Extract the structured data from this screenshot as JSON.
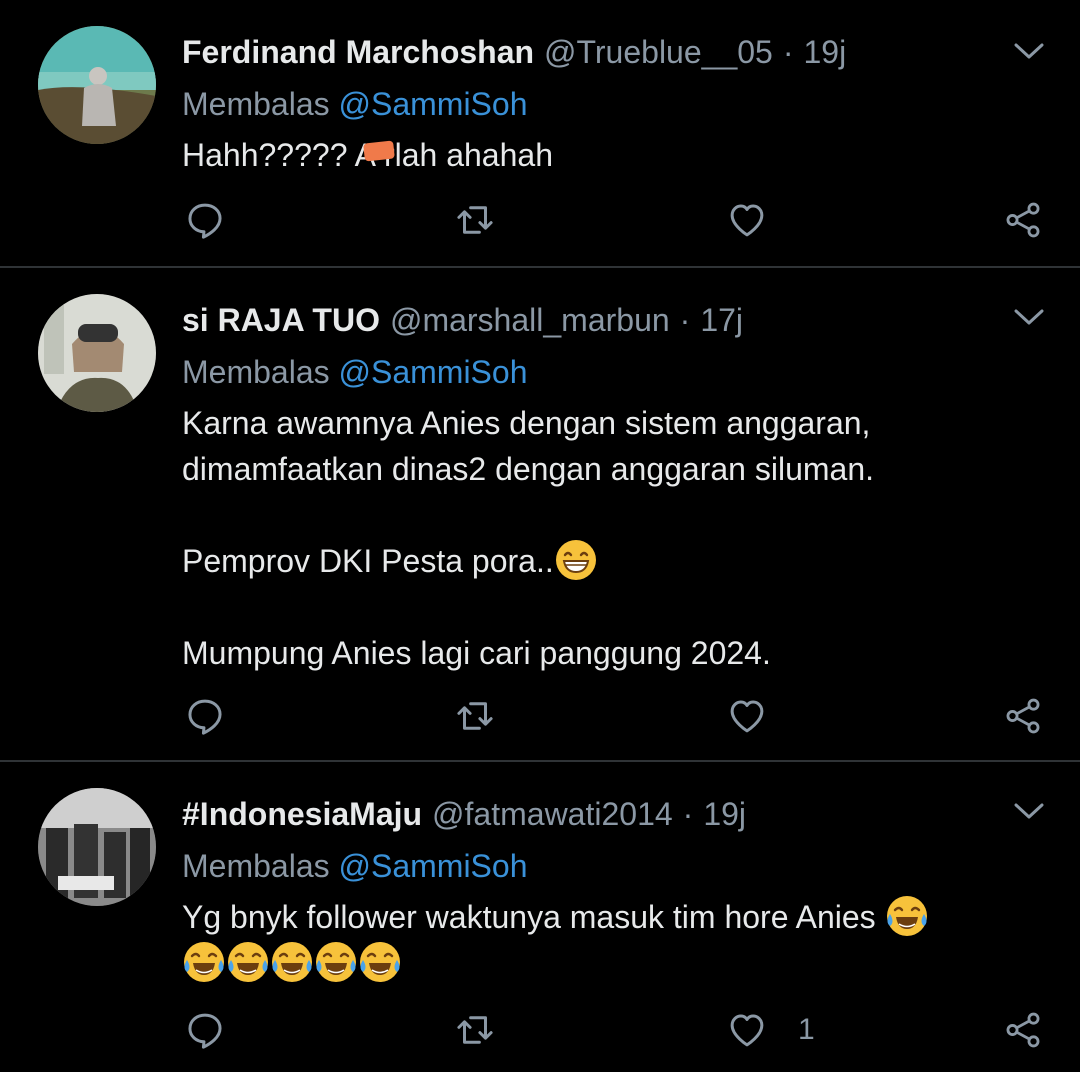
{
  "tweets": [
    {
      "display_name": "Ferdinand Marchoshan",
      "handle": "@Trueblue__05",
      "separator": "·",
      "time": "19j",
      "reply_prefix": "Membalas",
      "reply_to": "@SammiSoh",
      "text_before_redaction": "Hahh????? A",
      "text_after_redaction": "rlah ahahah",
      "like_count": ""
    },
    {
      "display_name": "si RAJA TUO",
      "handle": "@marshall_marbun",
      "separator": "·",
      "time": "17j",
      "reply_prefix": "Membalas",
      "reply_to": "@SammiSoh",
      "paragraphs": [
        "Karna awamnya Anies dengan sistem anggaran,",
        "dimamfaatkan dinas2 dengan anggaran siluman.",
        "",
        "Pemprov DKI Pesta pora..",
        "",
        "Mumpung Anies lagi cari panggung 2024."
      ],
      "like_count": ""
    },
    {
      "display_name": "#IndonesiaMaju",
      "handle": "@fatmawati2014",
      "separator": "·",
      "time": "19j",
      "reply_prefix": "Membalas",
      "reply_to": "@SammiSoh",
      "text": "Yg bnyk follower waktunya masuk tim hore Anies",
      "like_count": "1"
    }
  ],
  "icons": {
    "reply": "reply-icon",
    "retweet": "retweet-icon",
    "like": "heart-icon",
    "share": "share-icon",
    "menu": "chevron-down-icon",
    "emoji_grin": "grinning-emoji-icon",
    "emoji_tears": "tears-of-joy-emoji-icon"
  },
  "colors": {
    "background": "#000000",
    "divider": "#2f3336",
    "mention": "#3a91d8",
    "muted": "#8b98a5",
    "text": "#e7e9ea"
  }
}
